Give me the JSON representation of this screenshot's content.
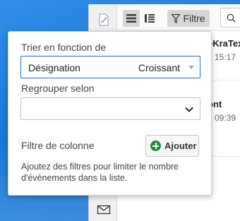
{
  "app": {
    "toolbar": {
      "filter_label": "Filtre",
      "icons": [
        "list-view-icon",
        "detail-view-icon",
        "filter-icon",
        "search-icon"
      ]
    },
    "rail_icons": [
      "document-icon",
      "mail-icon"
    ],
    "list_items": [
      {
        "title": "eKraTex",
        "time": "1 15:17"
      },
      {
        "title": "ont",
        "time": "1 09:39"
      }
    ]
  },
  "popover": {
    "sort_label": "Trier en fonction de",
    "sort_field": "Désignation",
    "sort_order": "Croissant",
    "group_label": "Regrouper selon",
    "group_value": "",
    "column_filter_label": "Filtre de colonne",
    "add_button_label": "Ajouter",
    "help_text": "Ajoutez des filtres pour limiter le nombre d'événements dans la liste."
  },
  "colors": {
    "desktop": "#1e78d8",
    "sort_border_active": "#1f6fc0",
    "add_icon": "#1f8a3a"
  }
}
